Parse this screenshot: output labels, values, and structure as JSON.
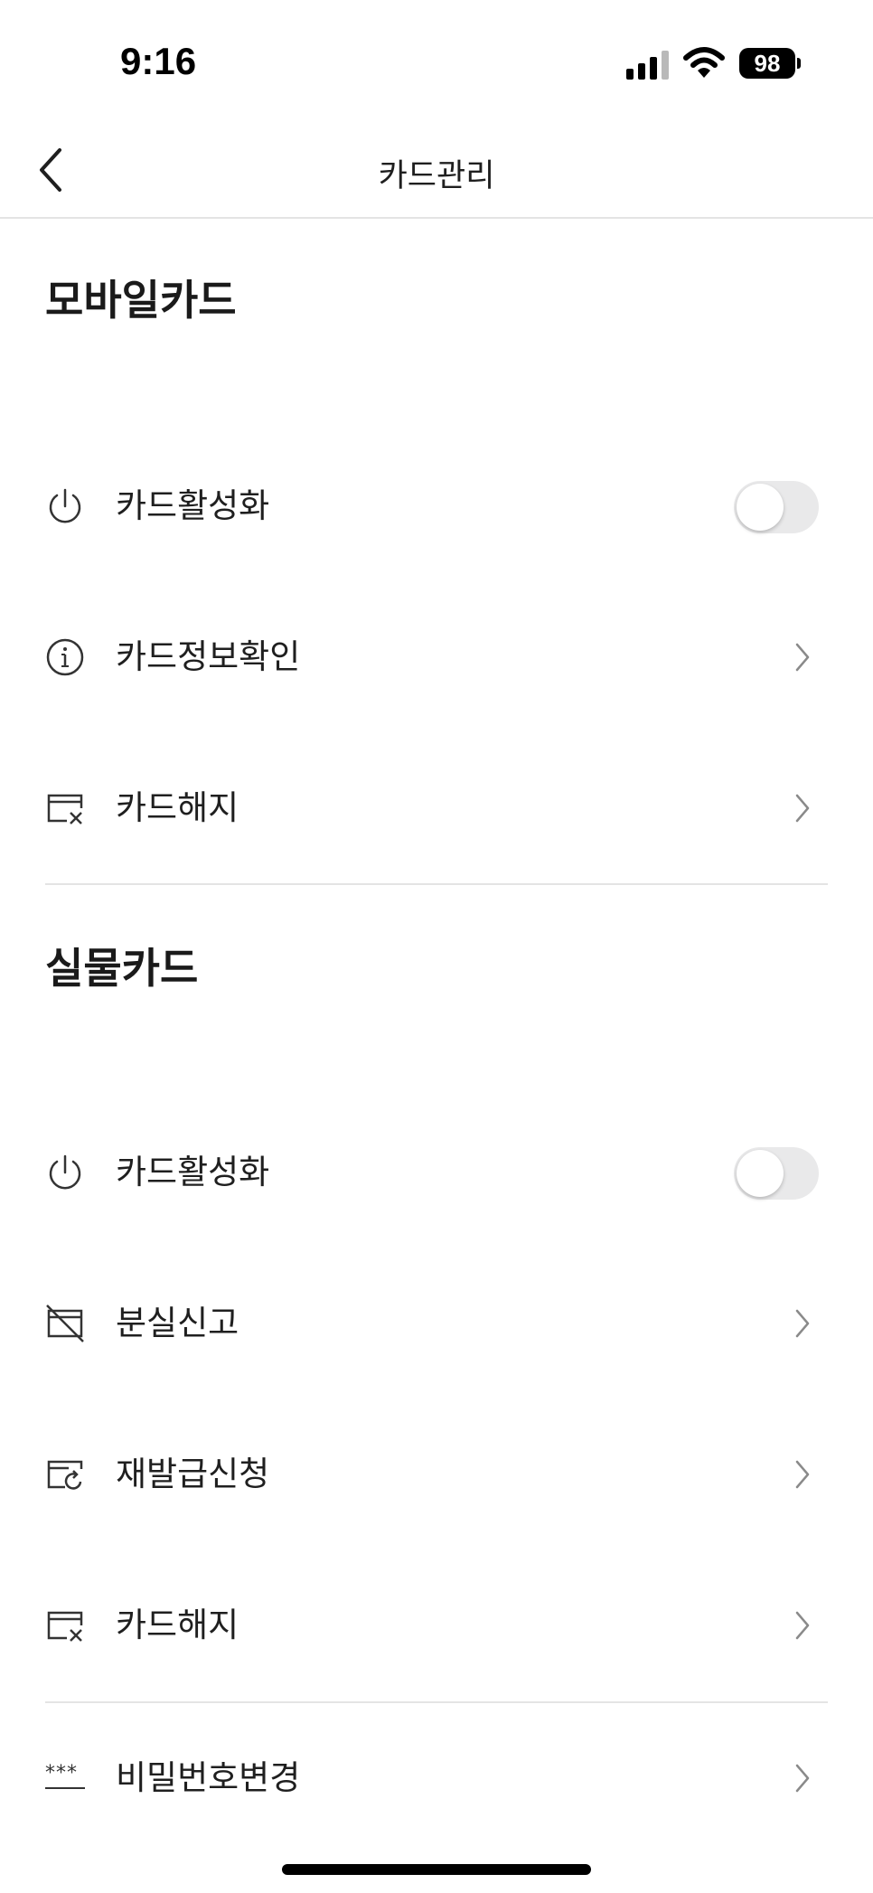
{
  "status_bar": {
    "time": "9:16",
    "battery": "98"
  },
  "header": {
    "title": "카드관리",
    "back_icon": "chevron-left-icon"
  },
  "mobile_card": {
    "section_title": "모바일카드",
    "items": [
      {
        "label": "카드활성화",
        "icon": "power-icon",
        "control": "toggle",
        "toggle_on": false
      },
      {
        "label": "카드정보확인",
        "icon": "info-circle-icon",
        "control": "chevron"
      },
      {
        "label": "카드해지",
        "icon": "card-cancel-icon",
        "control": "chevron"
      }
    ]
  },
  "physical_card": {
    "section_title": "실물카드",
    "items": [
      {
        "label": "카드활성화",
        "icon": "power-icon",
        "control": "toggle",
        "toggle_on": false
      },
      {
        "label": "분실신고",
        "icon": "card-lost-icon",
        "control": "chevron"
      },
      {
        "label": "재발급신청",
        "icon": "card-reissue-icon",
        "control": "chevron"
      },
      {
        "label": "카드해지",
        "icon": "card-cancel-icon",
        "control": "chevron"
      }
    ]
  },
  "password": {
    "label": "비밀번호변경",
    "icon": "password-asterisk-icon",
    "icon_text": "***"
  },
  "colors": {
    "text": "#1f1f1f",
    "icon": "#333333",
    "chevron": "#8a8a8a",
    "toggle_off": "#e9e9ea",
    "divider": "#e4e4e4"
  }
}
